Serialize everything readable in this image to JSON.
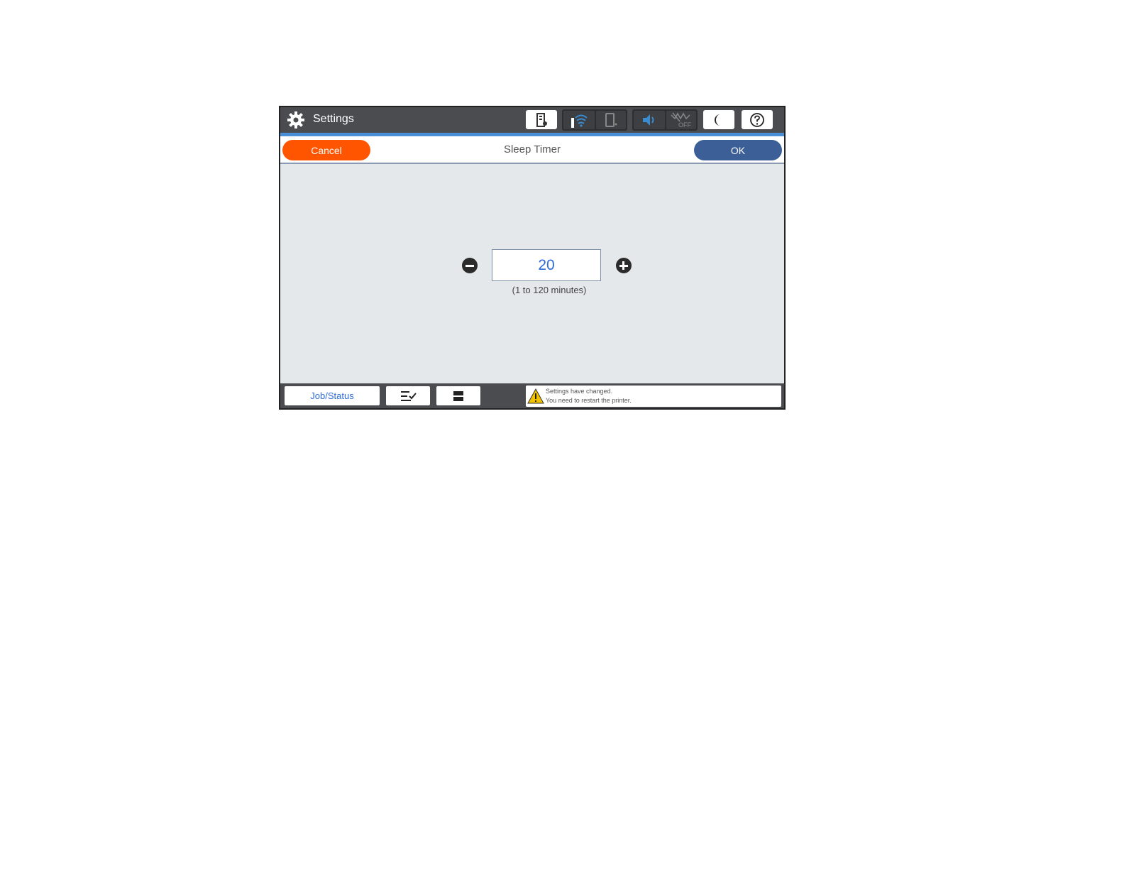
{
  "header": {
    "title": "Settings",
    "icons": [
      "gear-icon",
      "ink-level-icon",
      "wifi-icon",
      "wifi-direct-icon",
      "sound-icon",
      "quiet-mode-off-icon",
      "sleep-icon",
      "help-icon"
    ],
    "status_labels": {
      "quiet_mode": "OFF"
    }
  },
  "dialog": {
    "title": "Sleep Timer",
    "cancel_label": "Cancel",
    "ok_label": "OK"
  },
  "timer": {
    "value": "20",
    "range_hint": "(1 to 120 minutes)"
  },
  "footer": {
    "job_status_label": "Job/Status",
    "notice_line1": "Settings have changed.",
    "notice_line2": "You need to restart the printer."
  },
  "colors": {
    "cancel": "#ff5500",
    "ok": "#3b5f96",
    "accent_blue": "#4a90d9",
    "value_text": "#2c6bd8",
    "bar": "#4a4c50"
  }
}
